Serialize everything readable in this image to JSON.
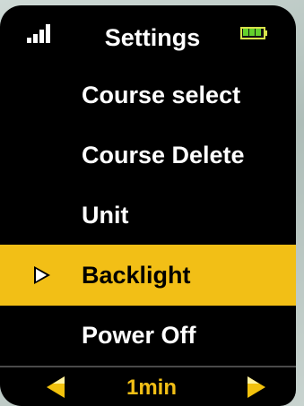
{
  "header": {
    "title": "Settings",
    "signal_icon": "signal-bars-icon",
    "battery_icon": "battery-full-icon"
  },
  "menu": {
    "items": [
      {
        "label": "Course select",
        "selected": false
      },
      {
        "label": "Course Delete",
        "selected": false
      },
      {
        "label": "Unit",
        "selected": false
      },
      {
        "label": "Backlight",
        "selected": true
      },
      {
        "label": "Power Off",
        "selected": false
      }
    ]
  },
  "footer": {
    "value": "1min",
    "left_icon": "chevron-left-icon",
    "right_icon": "chevron-right-icon"
  },
  "colors": {
    "background": "#000000",
    "highlight": "#f2bf16",
    "text": "#ffffff",
    "battery_fill": "#63d12c"
  }
}
